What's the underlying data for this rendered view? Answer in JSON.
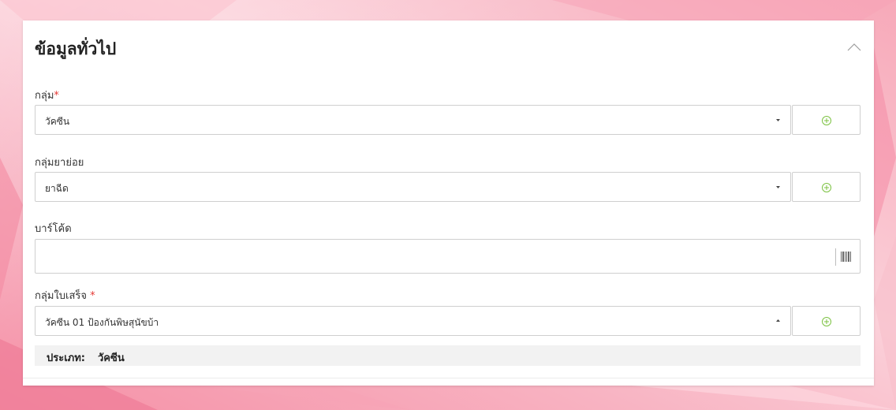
{
  "section": {
    "title": "ข้อมูลทั่วไป"
  },
  "fields": {
    "group": {
      "label": "กลุ่ม",
      "required_mark": "*",
      "value": "วัคซีน"
    },
    "subgroup": {
      "label": "กลุ่มยาย่อย",
      "value": "ยาฉีด"
    },
    "barcode": {
      "label": "บาร์โค้ด",
      "value": ""
    },
    "receipt_group": {
      "label": "กลุ่มใบเสร็จ ",
      "required_mark": "*",
      "value": "วัคซีน 01 ป้องกันพิษสุนัขบ้า"
    }
  },
  "type_info": {
    "label": "ประเภท:",
    "value": "วัคซีน"
  },
  "colors": {
    "accent_green": "#7cc242",
    "required_red": "#e53935"
  },
  "icons": {
    "add": "plus-circle-icon",
    "barcode": "barcode-icon",
    "collapse": "chevron-up-icon",
    "caret_down": "caret-down-icon",
    "caret_up": "caret-up-icon"
  }
}
